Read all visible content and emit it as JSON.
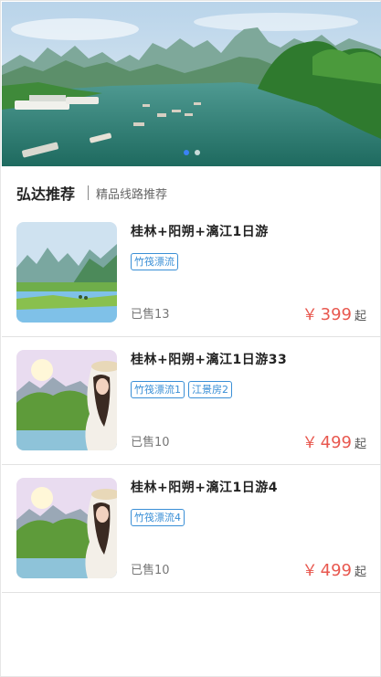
{
  "banner": {
    "slides": 2,
    "active_slide": 0,
    "colors": {
      "sky": "#d6e6f2",
      "mountain": "#5c8f6a",
      "river": "#2f7f74",
      "foliage": "#3f8a3a"
    }
  },
  "section": {
    "title": "弘达推荐",
    "subtitle": "精品线路推荐"
  },
  "products": [
    {
      "title": "桂林+阳朔+漓江1日游",
      "tags": [
        "竹筏漂流"
      ],
      "sold": "已售13",
      "currency": "￥",
      "price": "399",
      "price_suffix": "起",
      "thumb": "karst-landscape"
    },
    {
      "title": "桂林+阳朔+漓江1日游33",
      "tags": [
        "竹筏漂流1",
        "江景房2"
      ],
      "sold": "已售10",
      "currency": "￥",
      "price": "499",
      "price_suffix": "起",
      "thumb": "tourist-with-hat"
    },
    {
      "title": "桂林+阳朔+漓江1日游4",
      "tags": [
        "竹筏漂流4"
      ],
      "sold": "已售10",
      "currency": "￥",
      "price": "499",
      "price_suffix": "起",
      "thumb": "tourist-with-hat"
    }
  ],
  "theme": {
    "accent_blue": "#3a8fd6",
    "price_red": "#e8584f",
    "dot_active": "#3b82f6"
  }
}
